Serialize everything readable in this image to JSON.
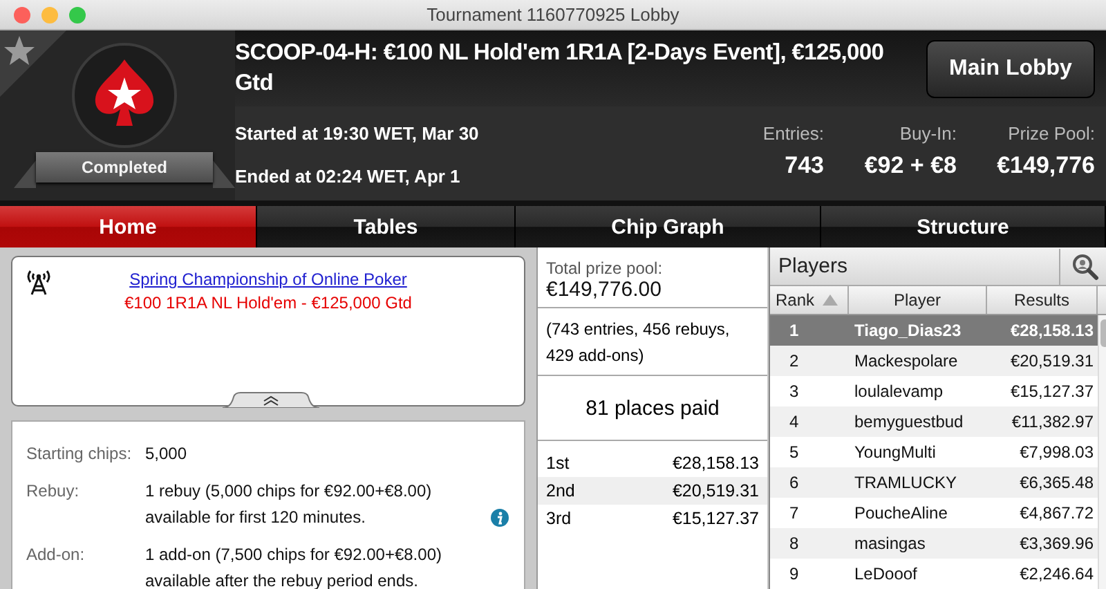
{
  "window": {
    "title": "Tournament 1160770925 Lobby"
  },
  "header": {
    "status": "Completed",
    "title": "SCOOP-04-H: €100 NL Hold'em 1R1A [2-Days Event], €125,000 Gtd",
    "started": "Started at 19:30 WET, Mar 30",
    "ended": "Ended at 02:24 WET, Apr 1",
    "main_lobby": "Main Lobby",
    "stats": [
      {
        "label": "Entries:",
        "value": "743"
      },
      {
        "label": "Buy-In:",
        "value": "€92 + €8"
      },
      {
        "label": "Prize Pool:",
        "value": "€149,776"
      }
    ]
  },
  "tabs": [
    {
      "label": "Home",
      "selected": true
    },
    {
      "label": "Tables",
      "selected": false
    },
    {
      "label": "Chip Graph",
      "selected": false
    },
    {
      "label": "Structure",
      "selected": false
    }
  ],
  "news": {
    "link": "Spring Championship of Online Poker",
    "subtitle": "€100 1R1A NL Hold'em - €125,000 Gtd"
  },
  "details": [
    {
      "label": "Starting chips:",
      "value": "5,000"
    },
    {
      "label": "Rebuy:",
      "value": "1 rebuy (5,000 chips for €92.00+€8.00) available for first 120 minutes.",
      "info": true
    },
    {
      "label": "Add-on:",
      "value": "1 add-on (7,500 chips for €92.00+€8.00) available after the rebuy period ends."
    }
  ],
  "prizes": {
    "total_label": "Total prize pool:",
    "total": "€149,776.00",
    "breakdown": "(743 entries, 456 rebuys, 429 add-ons)",
    "places_paid": "81 places paid",
    "places": [
      {
        "place": "1st",
        "amount": "€28,158.13"
      },
      {
        "place": "2nd",
        "amount": "€20,519.31"
      },
      {
        "place": "3rd",
        "amount": "€15,127.37"
      }
    ]
  },
  "players": {
    "title": "Players",
    "columns": [
      {
        "label": "Rank",
        "sorted": true
      },
      {
        "label": "Player",
        "sorted": false
      },
      {
        "label": "Results",
        "sorted": false
      }
    ],
    "rows": [
      {
        "rank": "1",
        "name": "Tiago_Dias23",
        "result": "€28,158.13",
        "selected": true
      },
      {
        "rank": "2",
        "name": "Mackespolare",
        "result": "€20,519.31",
        "selected": false
      },
      {
        "rank": "3",
        "name": "loulalevamp",
        "result": "€15,127.37",
        "selected": false
      },
      {
        "rank": "4",
        "name": "bemyguestbud",
        "result": "€11,382.97",
        "selected": false
      },
      {
        "rank": "5",
        "name": "YoungMulti",
        "result": "€7,998.03",
        "selected": false
      },
      {
        "rank": "6",
        "name": "TRAMLUCKY",
        "result": "€6,365.48",
        "selected": false
      },
      {
        "rank": "7",
        "name": "PoucheAline",
        "result": "€4,867.72",
        "selected": false
      },
      {
        "rank": "8",
        "name": "masingas",
        "result": "€3,369.96",
        "selected": false
      },
      {
        "rank": "9",
        "name": "LeDooof",
        "result": "€2,246.64",
        "selected": false
      }
    ]
  }
}
